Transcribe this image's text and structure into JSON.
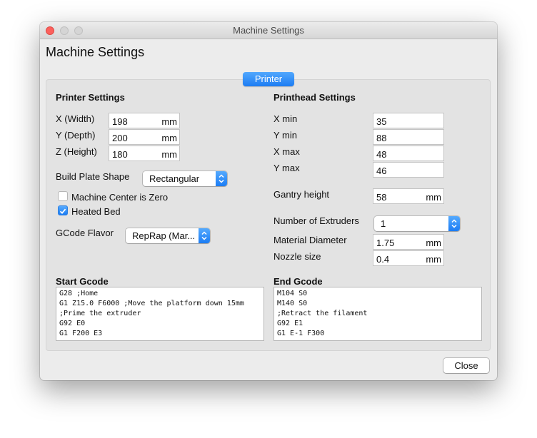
{
  "window": {
    "title": "Machine Settings"
  },
  "dialog": {
    "title": "Machine Settings"
  },
  "tab": {
    "label": "Printer"
  },
  "printer": {
    "header": "Printer Settings",
    "x_label": "X (Width)",
    "x_value": "198",
    "y_label": "Y (Depth)",
    "y_value": "200",
    "z_label": "Z (Height)",
    "z_value": "180",
    "unit": "mm",
    "build_plate_label": "Build Plate Shape",
    "build_plate_value": "Rectangular",
    "center_zero_label": "Machine Center is Zero",
    "center_zero_checked": false,
    "heated_bed_label": "Heated Bed",
    "heated_bed_checked": true,
    "gcode_flavor_label": "GCode Flavor",
    "gcode_flavor_value": "RepRap (Mar..."
  },
  "printhead": {
    "header": "Printhead Settings",
    "xmin_label": "X min",
    "xmin_value": "35",
    "ymin_label": "Y min",
    "ymin_value": "88",
    "xmax_label": "X max",
    "xmax_value": "48",
    "ymax_label": "Y max",
    "ymax_value": "46",
    "gantry_label": "Gantry height",
    "gantry_value": "58",
    "extruders_label": "Number of Extruders",
    "extruders_value": "1",
    "material_label": "Material Diameter",
    "material_value": "1.75",
    "nozzle_label": "Nozzle size",
    "nozzle_value": "0.4",
    "unit": "mm"
  },
  "start_gcode": {
    "label": "Start Gcode",
    "text": "G28 ;Home\nG1 Z15.0 F6000 ;Move the platform down 15mm\n;Prime the extruder\nG92 E0\nG1 F200 E3"
  },
  "end_gcode": {
    "label": "End Gcode",
    "text": "M104 S0\nM140 S0\n;Retract the filament\nG92 E1\nG1 E-1 F300"
  },
  "buttons": {
    "close": "Close"
  },
  "colors": {
    "accent": "#1c7cf3",
    "close_light": "#fc605c"
  }
}
